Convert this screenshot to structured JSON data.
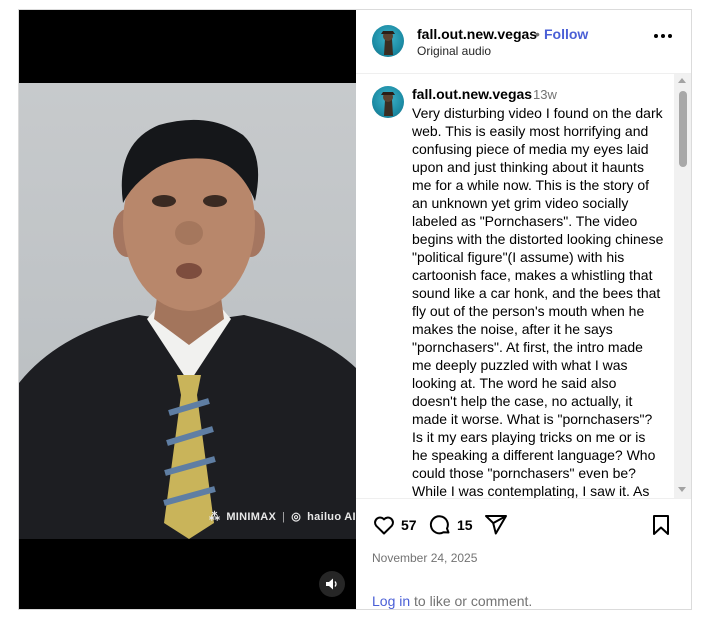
{
  "media": {
    "watermark_brand1": "MINIMAX",
    "watermark_sep": "|",
    "watermark_brand2": "hailuo AI",
    "audio_icon": "speaker-icon"
  },
  "header": {
    "username": "fall.out.new.vegas",
    "separator": "•",
    "follow_label": "Follow",
    "subtitle": "Original audio",
    "more_icon": "more-icon"
  },
  "comment": {
    "username": "fall.out.new.vegas",
    "time": "13w",
    "text": "Very disturbing video I found on the dark web. This is easily most horrifying and confusing piece of media my eyes laid upon and just thinking about it haunts me for a while now. This is the story of an unknown yet grim video socially labeled as \"Pornchasers\". The video begins with the distorted looking chinese \"political figure\"(I assume) with his cartoonish face, makes a whistling that sound like a car honk, and the bees that fly out of the person's mouth when he makes the noise, after it he says \"pornchasers\". At first, the intro made me deeply puzzled with what I was looking at. The word he said also doesn't help the case, no actually, it made it worse. What is \"pornchasers\"? Is it my ears playing tricks on me or is he speaking a different language? Who could those \"pornchasers\" even be? While I was contemplating, I saw it. As"
  },
  "actions": {
    "like_count": "57",
    "comment_count": "15",
    "date": "November 24, 2025",
    "login_link": "Log in",
    "login_rest": " to like or comment."
  }
}
